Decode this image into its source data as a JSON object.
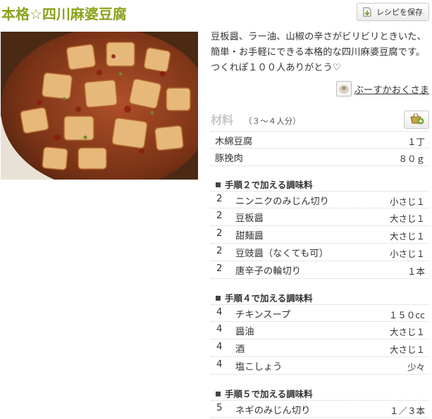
{
  "recipe": {
    "title": "本格☆四川麻婆豆腐",
    "save_label": "レシピを保存",
    "description": "豆板醤、ラー油、山椒の辛さがビリビリときいた、簡単・お手軽にできる本格的な四川麻婆豆腐です。つくれぽ１００人ありがとう♡",
    "author": "ぶーすかおくさま"
  },
  "ingredients": {
    "heading": "材料",
    "servings": "（３～４人分）",
    "base": [
      {
        "name": "木綿豆腐",
        "qty": "１丁"
      },
      {
        "name": "豚挽肉",
        "qty": "８０ｇ"
      }
    ],
    "sections": [
      {
        "title": "手順２で加える調味料",
        "items": [
          {
            "step": "2",
            "name": "ニンニクのみじん切り",
            "qty": "小さじ１"
          },
          {
            "step": "2",
            "name": "豆板醤",
            "qty": "大さじ１"
          },
          {
            "step": "2",
            "name": "甜麺醤",
            "qty": "大さじ１"
          },
          {
            "step": "2",
            "name": "豆豉醤（なくても可）",
            "qty": "小さじ１"
          },
          {
            "step": "2",
            "name": "唐辛子の輪切り",
            "qty": "１本"
          }
        ]
      },
      {
        "title": "手順４で加える調味料",
        "items": [
          {
            "step": "4",
            "name": "チキンスープ",
            "qty": "１５０cc"
          },
          {
            "step": "4",
            "name": "醤油",
            "qty": "大さじ１"
          },
          {
            "step": "4",
            "name": "酒",
            "qty": "大さじ１"
          },
          {
            "step": "4",
            "name": "塩こしょう",
            "qty": "少々"
          }
        ]
      },
      {
        "title": "手順５で加える調味料",
        "items": [
          {
            "step": "5",
            "name": "ネギのみじん切り",
            "qty": "１／３本"
          }
        ]
      }
    ]
  },
  "icons": {
    "save": "save-recipe-icon",
    "cart": "shopping-basket-icon",
    "photo": "mapo-tofu-photo"
  },
  "colors": {
    "title": "#8aa31e",
    "ingredients_heading": "#c7c7c7"
  }
}
